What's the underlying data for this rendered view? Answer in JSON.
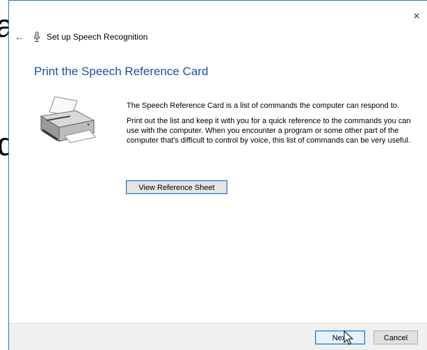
{
  "background": {
    "glyph_top": "a",
    "glyph_mid": "d"
  },
  "window": {
    "close_glyph": "×",
    "back_glyph": "←",
    "title": "Set up Speech Recognition"
  },
  "page": {
    "heading": "Print the Speech Reference Card",
    "paragraph1": "The Speech Reference Card is a list of commands the computer can respond to.",
    "paragraph2": "Print out the list and keep it with you for a quick reference to the commands you can use with the computer. When you encounter a program or some other part of the computer that's difficult to control by voice, this list of commands can be very useful.",
    "view_button": "View Reference Sheet"
  },
  "footer": {
    "next_label": "Next",
    "cancel_label": "Cancel"
  },
  "colors": {
    "heading": "#1c4fa3",
    "accent_border": "#0078d7",
    "footer_bg": "#f0f0f0"
  },
  "icons": {
    "mic": "microphone-icon",
    "printer": "printer-icon",
    "back": "back-arrow-icon",
    "close": "close-icon",
    "cursor": "mouse-cursor-icon"
  }
}
